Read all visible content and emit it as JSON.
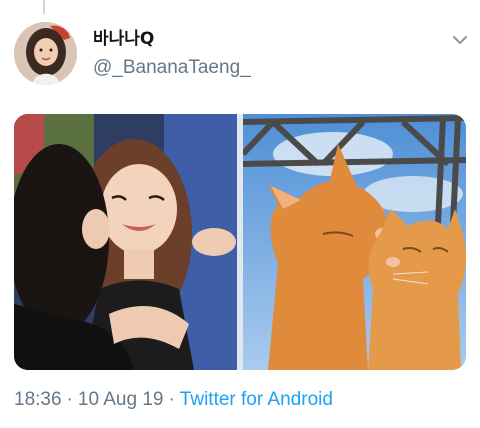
{
  "tweet": {
    "display_name": "바나나Q",
    "handle": "@_BananaTaeng_",
    "time": "18:36",
    "date": "10 Aug 19",
    "separator": "·",
    "source": "Twitter for Android"
  },
  "media": [
    {
      "name": "photo-kiss-left",
      "kind": "photo"
    },
    {
      "name": "photo-cats-right",
      "kind": "photo"
    }
  ],
  "icons": {
    "menu": "chevron-down-icon",
    "avatar": "avatar"
  },
  "colors": {
    "primary_text": "#14171a",
    "secondary_text": "#657786",
    "link": "#1da1f2"
  }
}
